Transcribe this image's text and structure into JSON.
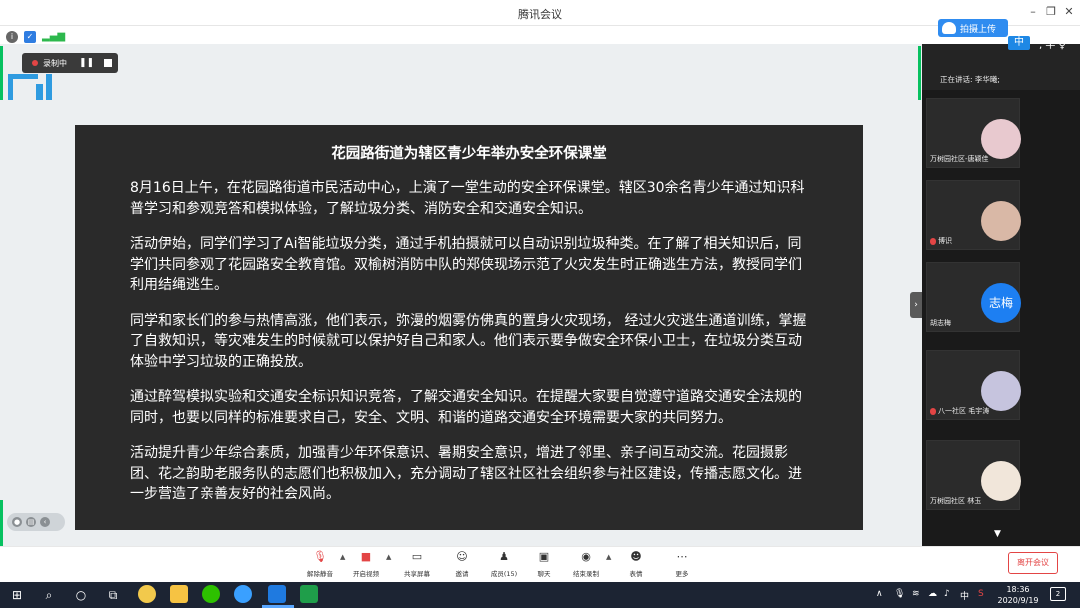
{
  "window": {
    "title": "腾讯会议"
  },
  "cloud_upload": {
    "label": "拍摄上传"
  },
  "recording": {
    "label": "录制中"
  },
  "slide": {
    "title": "花园路街道为辖区青少年举办安全环保课堂",
    "paragraphs": [
      "8月16日上午，在花园路街道市民活动中心，上演了一堂生动的安全环保课堂。辖区30余名青少年通过知识科普学习和参观竞答和模拟体验，了解垃圾分类、消防安全和交通安全知识。",
      "活动伊始，同学们学习了Ai智能垃圾分类，通过手机拍摄就可以自动识别垃圾种类。在了解了相关知识后，同学们共同参观了花园路安全教育馆。双榆树消防中队的郑侠现场示范了火灾发生时正确逃生方法，教授同学们利用结绳逃生。",
      "同学和家长们的参与热情高涨，他们表示，弥漫的烟雾仿佛真的置身火灾现场， 经过火灾逃生通道训练，掌握了自救知识，等灾难发生的时候就可以保护好自己和家人。他们表示要争做安全环保小卫士，在垃圾分类互动体验中学习垃圾的正确投放。",
      "通过醉驾模拟实验和交通安全标识知识竞答，了解交通安全知识。在提醒大家要自觉遵守道路交通安全法规的同时，也要以同样的标准要求自己，安全、文明、和谐的道路交通安全环境需要大家的共同努力。",
      "活动提升青少年综合素质，加强青少年环保意识、暑期安全意识，增进了邻里、亲子间互动交流。花园摄影团、花之韵助老服务队的志愿们也积极加入，充分调动了辖区社区社会组织参与社区建设，传播志愿文化。进一步营造了亲善友好的社会风尚。"
    ]
  },
  "panel": {
    "speaking": "正在讲话: 李华曦;",
    "participants": [
      {
        "name": "万树园社区-唐颖佳",
        "muted": false
      },
      {
        "name": "博识",
        "muted": true
      },
      {
        "name": "胡志梅",
        "muted": false,
        "avatar_text": "志梅"
      },
      {
        "name": "八一社区 毛宇涛",
        "muted": true
      },
      {
        "name": "万树园社区 林玉",
        "muted": false
      }
    ]
  },
  "toolbar": {
    "buttons": [
      {
        "label": "解除静音",
        "icon": "mic-muted-icon"
      },
      {
        "label": "开启视频",
        "icon": "camera-off-icon"
      },
      {
        "label": "共享屏幕",
        "icon": "share-screen-icon"
      },
      {
        "label": "邀请",
        "icon": "invite-icon"
      },
      {
        "label": "成员(15)",
        "icon": "members-icon"
      },
      {
        "label": "聊天",
        "icon": "chat-icon"
      },
      {
        "label": "结束录制",
        "icon": "stop-record-icon"
      },
      {
        "label": "表情",
        "icon": "emoji-icon"
      },
      {
        "label": "更多",
        "icon": "more-icon"
      }
    ],
    "leave_label": "离开会议"
  },
  "taskbar": {
    "time": "18:36",
    "date": "2020/9/19",
    "ime": "中",
    "notifications": "2"
  },
  "colors": {
    "accent_green": "#07c160",
    "accent_blue": "#1d7ff2",
    "danger": "#e34545"
  }
}
